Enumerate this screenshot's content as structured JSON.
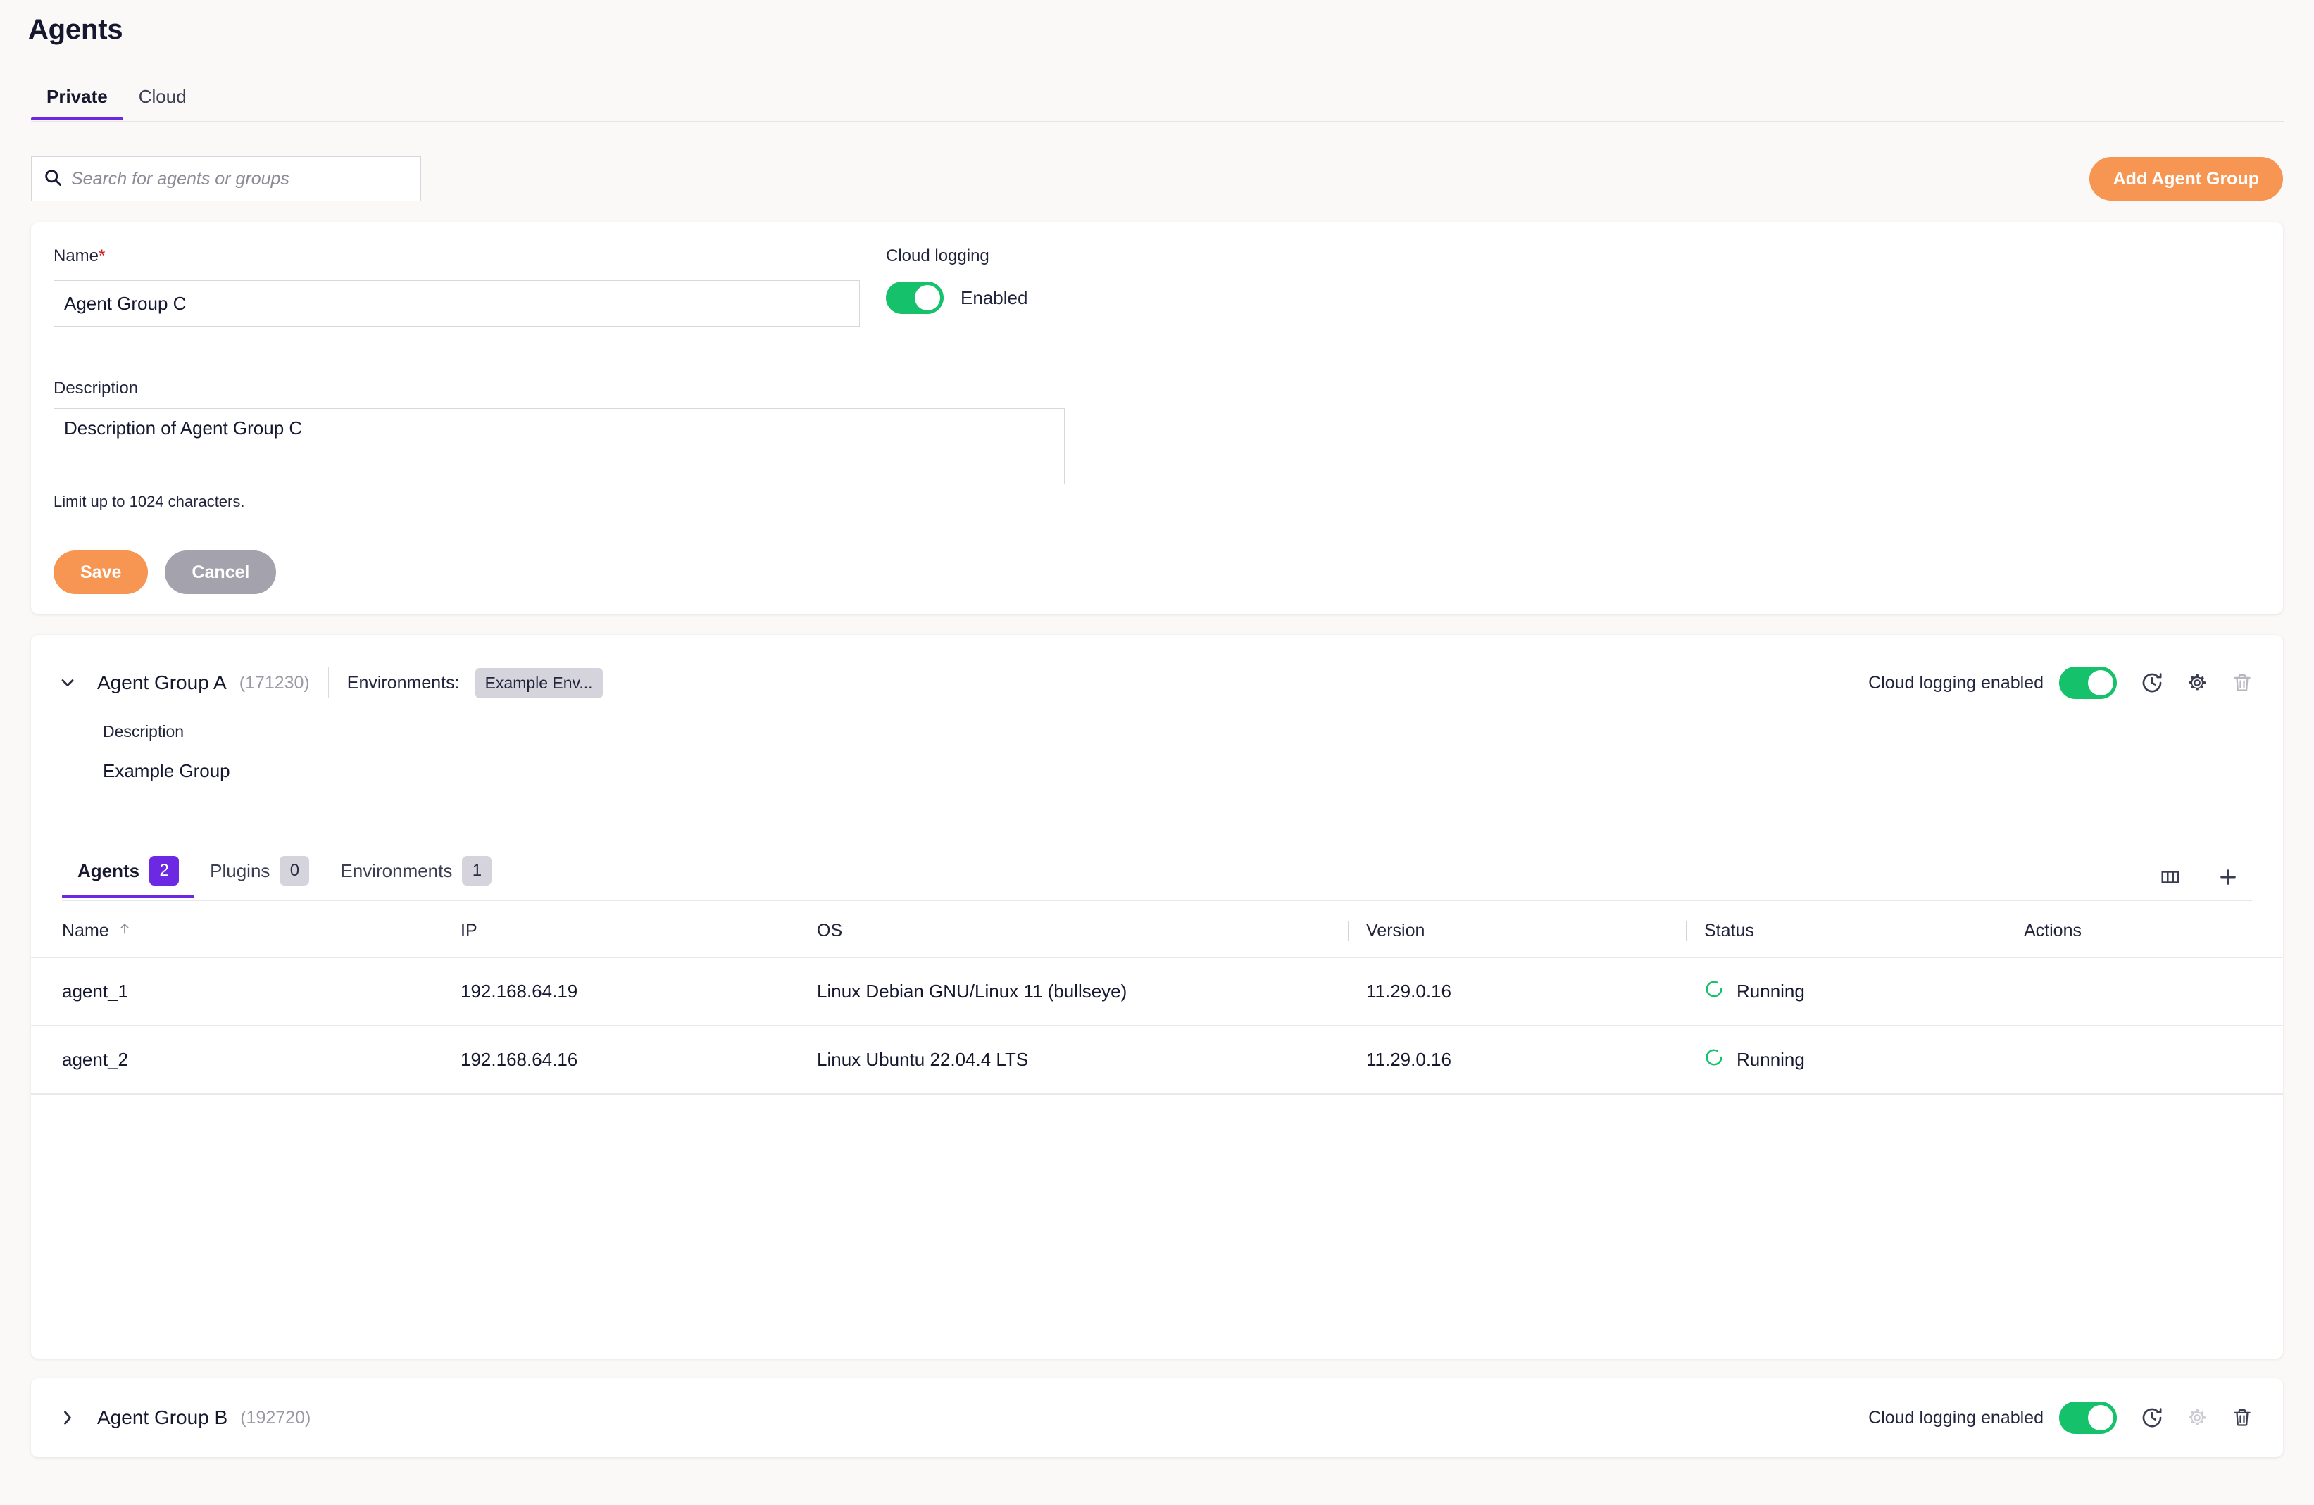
{
  "header": {
    "title": "Agents"
  },
  "top_tabs": [
    {
      "label": "Private",
      "active": true
    },
    {
      "label": "Cloud",
      "active": false
    }
  ],
  "search": {
    "placeholder": "Search for agents or groups",
    "value": "",
    "icon": "search-icon"
  },
  "add_group_button": {
    "label": "Add Agent Group",
    "color": "#f79552"
  },
  "form": {
    "name_label": "Name",
    "required_marker": "*",
    "name_value": "Agent Group C",
    "cloud_logging_label": "Cloud logging",
    "cloud_logging_state": "Enabled",
    "cloud_logging_on": true,
    "description_label": "Description",
    "description_value": "Description of Agent Group C",
    "description_hint": "Limit up to 1024 characters.",
    "save_label": "Save",
    "cancel_label": "Cancel"
  },
  "groups": [
    {
      "name": "Agent Group A",
      "id": "(171230)",
      "expanded": true,
      "environments_label": "Environments:",
      "environment_chip": "Example Env...",
      "cloud_logging_text": "Cloud logging enabled",
      "cloud_logging_on": true,
      "description_label": "Description",
      "description_value": "Example Group",
      "actions": [
        "history-icon",
        "gear-icon",
        "trash-icon"
      ]
    },
    {
      "name": "Agent Group B",
      "id": "(192720)",
      "expanded": false,
      "cloud_logging_text": "Cloud logging enabled",
      "cloud_logging_on": true,
      "actions": [
        "history-icon",
        "gear-icon",
        "trash-icon"
      ]
    }
  ],
  "inner_tabs": [
    {
      "label": "Agents",
      "count": "2",
      "active": true
    },
    {
      "label": "Plugins",
      "count": "0",
      "active": false
    },
    {
      "label": "Environments",
      "count": "1",
      "active": false
    }
  ],
  "table_tools": [
    "columns-icon",
    "add-icon"
  ],
  "table": {
    "columns": [
      "Name",
      "IP",
      "OS",
      "Version",
      "Status",
      "Actions"
    ],
    "sort_column": "Name",
    "sort_direction": "asc",
    "rows": [
      {
        "name": "agent_1",
        "ip": "192.168.64.19",
        "os": "Linux Debian GNU/Linux 11 (bullseye)",
        "version": "11.29.0.16",
        "status": "Running"
      },
      {
        "name": "agent_2",
        "ip": "192.168.64.16",
        "os": "Linux Ubuntu 22.04.4 LTS",
        "version": "11.29.0.16",
        "status": "Running"
      }
    ]
  },
  "colors": {
    "accent_purple": "#6d28e3",
    "accent_orange": "#f79552",
    "toggle_green": "#15c26b",
    "status_green": "#15c26b",
    "page_bg": "#faf9f7"
  }
}
